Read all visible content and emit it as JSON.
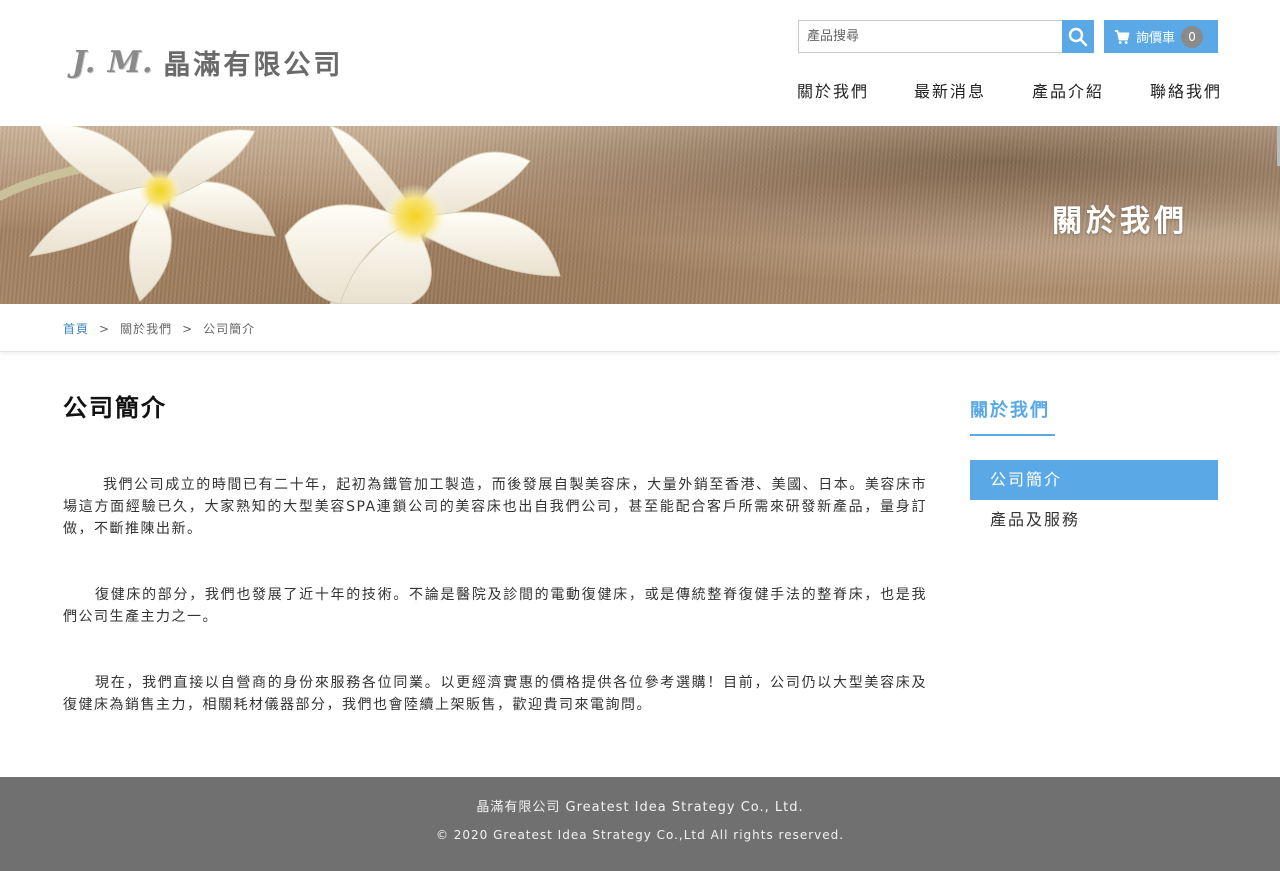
{
  "header": {
    "logo_mark": "J. M.",
    "logo_text": "晶滿有限公司",
    "search_placeholder": "產品搜尋",
    "cart_label": "詢價車",
    "cart_count": "0",
    "nav": [
      {
        "label": "關於我們"
      },
      {
        "label": "最新消息"
      },
      {
        "label": "產品介紹"
      },
      {
        "label": "聯絡我們"
      }
    ]
  },
  "banner": {
    "title": "關於我們"
  },
  "breadcrumb": {
    "home": "首頁",
    "sep": ">",
    "section": "關於我們",
    "current": "公司簡介"
  },
  "main": {
    "title": "公司簡介",
    "paragraphs": [
      "我們公司成立的時間已有二十年，起初為鐵管加工製造，而後發展自製美容床，大量外銷至香港、美國、日本。美容床市場這方面經驗已久，大家熟知的大型美容SPA連鎖公司的美容床也出自我們公司，甚至能配合客戶所需來研發新產品，量身訂做，不斷推陳出新。",
      "復健床的部分，我們也發展了近十年的技術。不論是醫院及診間的電動復健床，或是傳統整脊復健手法的整脊床，也是我們公司生產主力之一。",
      "現在，我們直接以自營商的身份來服務各位同業。以更經濟實惠的價格提供各位參考選購！目前，公司仍以大型美容床及復健床為銷售主力，相關耗材儀器部分，我們也會陸續上架販售，歡迎貴司來電詢問。"
    ]
  },
  "sidebar": {
    "title": "關於我們",
    "items": [
      {
        "label": "公司簡介",
        "active": true
      },
      {
        "label": "產品及服務",
        "active": false
      }
    ]
  },
  "footer": {
    "company": "晶滿有限公司 Greatest Idea Strategy Co., Ltd.",
    "copyright": "© 2020 Greatest Idea Strategy Co.,Ltd All rights reserved."
  },
  "colors": {
    "accent": "#5aa9e6",
    "footer_bg": "#707070",
    "link": "#3b87c4"
  },
  "icons": {
    "search": "search-icon",
    "cart": "cart-icon"
  }
}
